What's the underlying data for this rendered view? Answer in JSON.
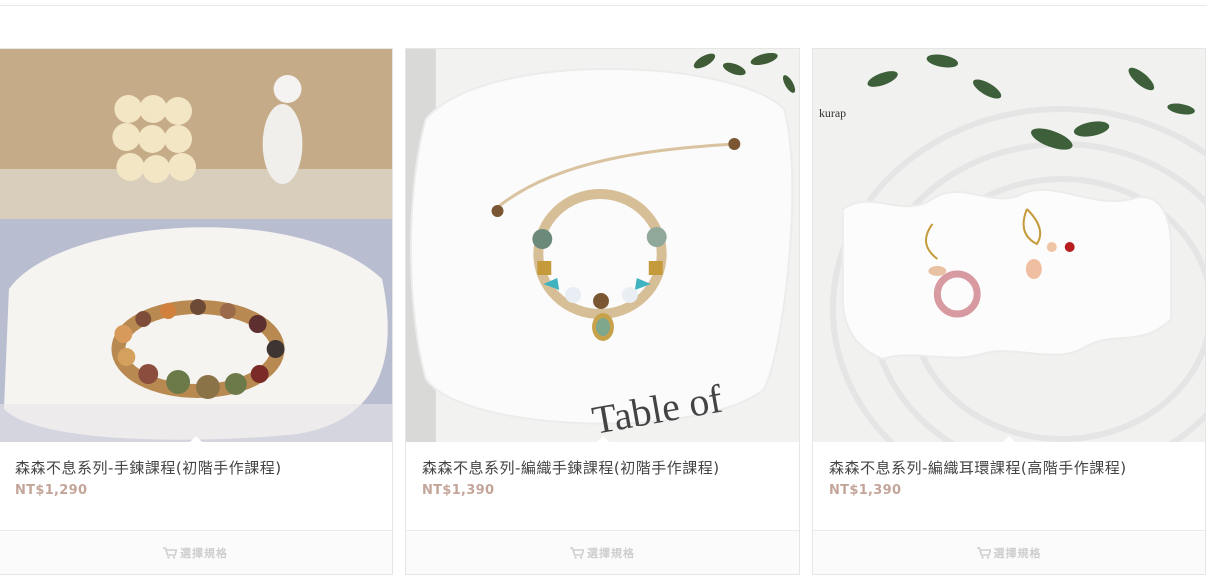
{
  "products": [
    {
      "title": "森森不息系列-手鍊課程(初階手作課程)",
      "price": "NT$1,290",
      "action_label": "選擇規格",
      "image_desc_icon": "photo-icon"
    },
    {
      "title": "森森不息系列-編織手鍊課程(初階手作課程)",
      "price": "NT$1,390",
      "action_label": "選擇規格",
      "image_desc_icon": "photo-icon",
      "photo_text": "Table of"
    },
    {
      "title": "森森不息系列-編織耳環課程(高階手作課程)",
      "price": "NT$1,390",
      "action_label": "選擇規格",
      "image_desc_icon": "photo-icon",
      "photo_text": "kurap"
    }
  ],
  "colors": {
    "price": "#c4a59a",
    "title": "#444444",
    "action": "#cfcfcf"
  }
}
